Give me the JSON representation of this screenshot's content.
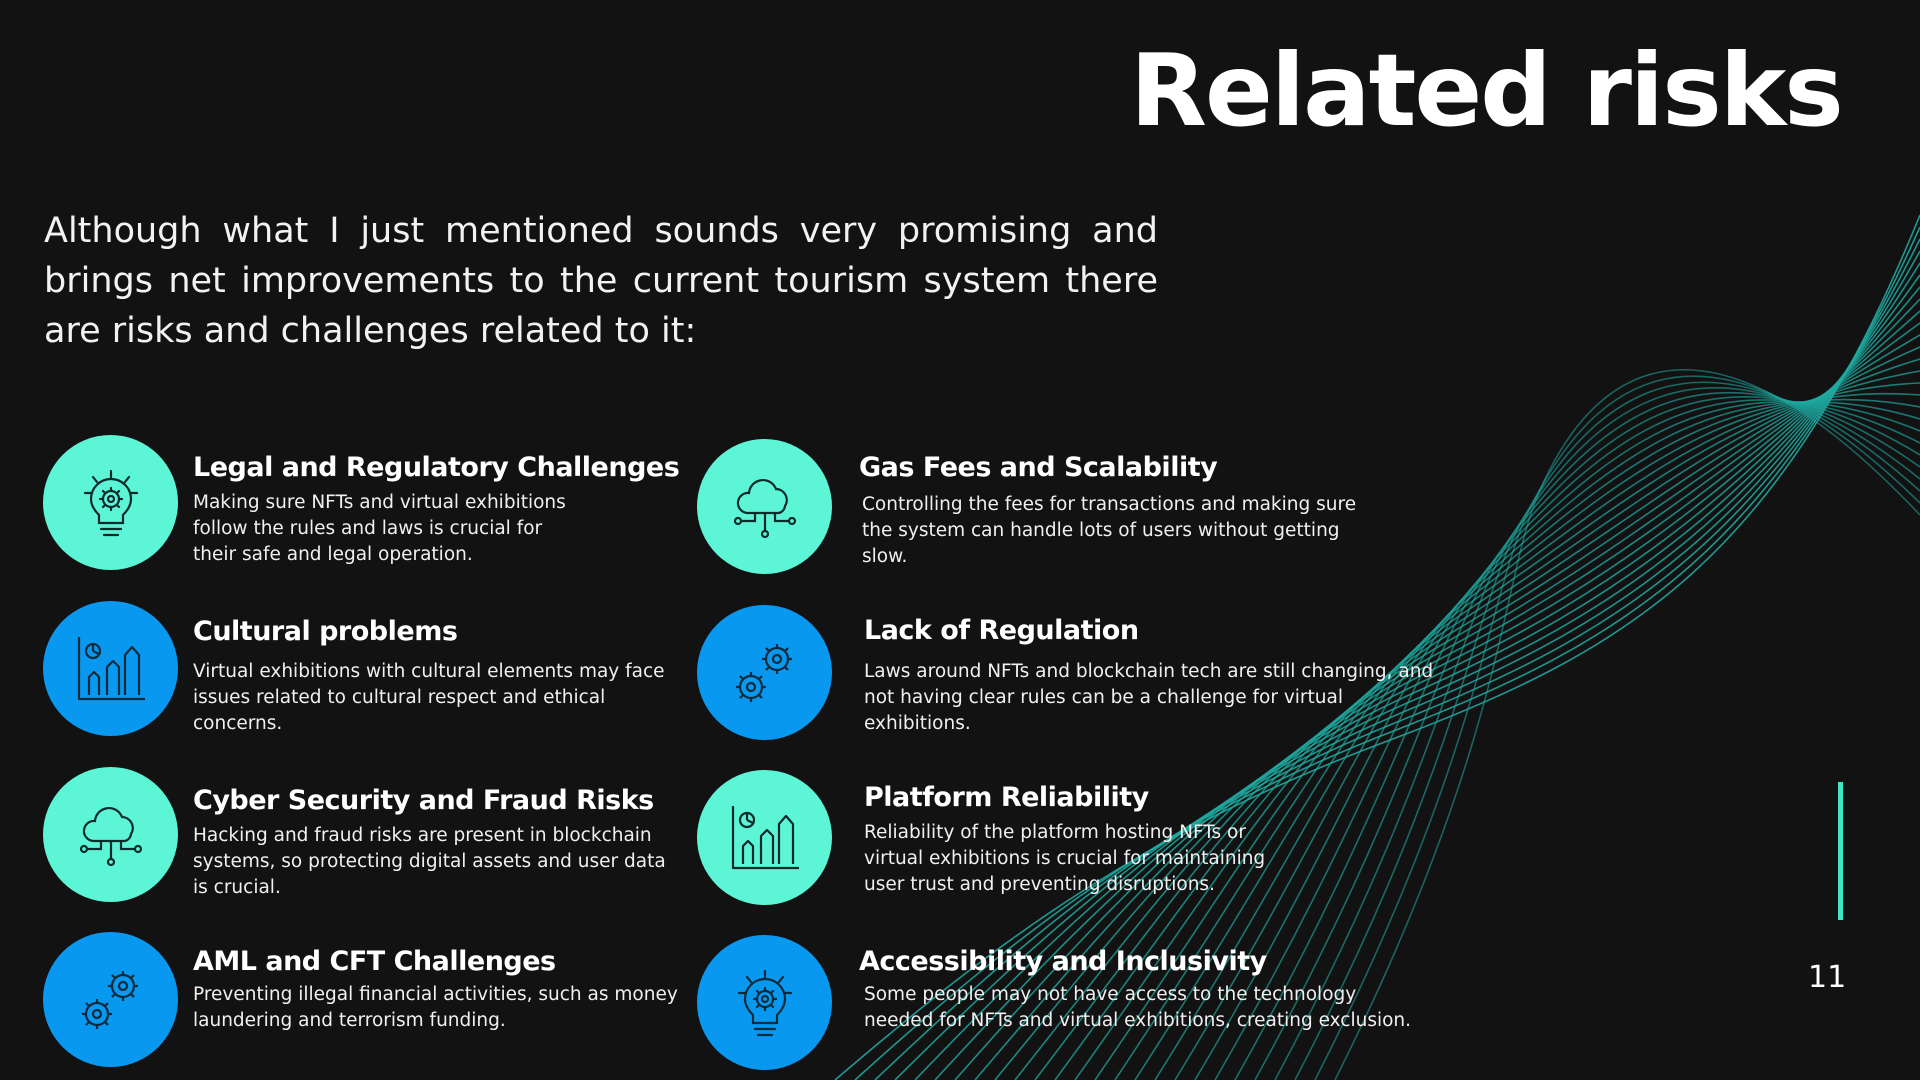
{
  "slide": {
    "title": "Related risks",
    "intro": "Although what I just mentioned sounds very promising and brings net improvements to the current tourism system there are risks and challenges related to it:",
    "page_number": "11"
  },
  "colors": {
    "background": "#121213",
    "mint": "#5cf5d6",
    "blue": "#0998f0",
    "wave": "#1fa9a0",
    "accent_line": "#3ee6c4"
  },
  "risks": [
    {
      "title": "Legal and Regulatory Challenges",
      "desc": "Making sure NFTs and virtual exhibitions follow the rules and laws is crucial for their safe and legal operation.",
      "icon": "lightbulb-gear-icon",
      "circle": "mint"
    },
    {
      "title": "Gas Fees and Scalability",
      "desc": "Controlling the fees for transactions and making sure the system can handle lots of users without getting slow.",
      "icon": "cloud-network-icon",
      "circle": "mint"
    },
    {
      "title": "Cultural problems",
      "desc": "Virtual exhibitions with cultural elements may face issues related to cultural respect and ethical concerns.",
      "icon": "growth-chart-icon",
      "circle": "blue"
    },
    {
      "title": "Lack of Regulation",
      "desc": "Laws around NFTs and blockchain tech are still changing, and not having clear rules can be a challenge for virtual exhibitions.",
      "icon": "gears-icon",
      "circle": "blue"
    },
    {
      "title": "Cyber Security and Fraud Risks",
      "desc": "Hacking and fraud risks are present in blockchain systems, so protecting digital assets and user data is crucial.",
      "icon": "cloud-network-icon",
      "circle": "mint"
    },
    {
      "title": "Platform Reliability",
      "desc": "Reliability of the platform hosting NFTs or virtual exhibitions is crucial for maintaining user trust and preventing disruptions.",
      "icon": "growth-chart-icon",
      "circle": "mint"
    },
    {
      "title": "AML and CFT Challenges",
      "desc": "Preventing illegal financial activities, such as money laundering and terrorism funding.",
      "icon": "gears-icon",
      "circle": "blue"
    },
    {
      "title": "Accessibility and Inclusivity",
      "desc": "Some people may not have access to the technology needed for NFTs and virtual exhibitions, creating exclusion.",
      "icon": "lightbulb-gear-icon",
      "circle": "blue"
    }
  ]
}
